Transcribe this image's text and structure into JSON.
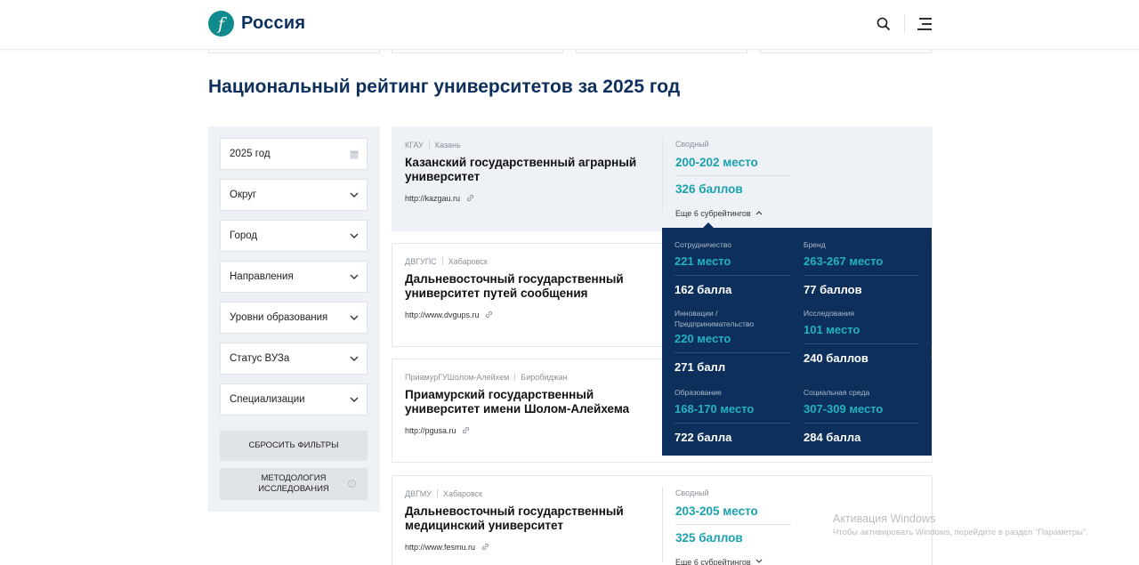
{
  "header": {
    "logo_glyph": "f",
    "logo_text": "Россия",
    "brand_color": "#0f8a8e",
    "search_icon": "search-icon",
    "menu_icon": "menu-icon"
  },
  "page": {
    "title": "Национальный рейтинг университетов за 2025 год"
  },
  "filters": {
    "year": "2025 год",
    "selects": [
      "Округ",
      "Город",
      "Направления",
      "Уровни образования",
      "Статус ВУЗа",
      "Специализации"
    ],
    "reset_label": "СБРОСИТЬ ФИЛЬТРЫ",
    "methodology_line1": "МЕТОДОЛОГИЯ",
    "methodology_line2": "ИССЛЕДОВАНИЯ",
    "info_glyph": "i"
  },
  "universities": [
    {
      "abbr": "КГАУ",
      "city": "Казань",
      "name": "Казанский государственный аграрный университет",
      "url": "http://kazgau.ru",
      "summary_label": "Сводный",
      "place": "200-202 место",
      "points": "326 баллов",
      "more": "Еще 6 субрейтингов",
      "expanded": true
    },
    {
      "abbr": "ДВГУПС",
      "city": "Хабаровск",
      "name": "Дальневосточный государственный университет путей сообщения",
      "url": "http://www.dvgups.ru"
    },
    {
      "abbr": "ПриамурГУШолом-Алейхем",
      "city": "Биробиджан",
      "name": "Приамурский государственный университет имени Шолом-Алейхема",
      "url": "http://pgusa.ru"
    },
    {
      "abbr": "ДВГМУ",
      "city": "Хабаровск",
      "name": "Дальневосточный государственный медицинский университет",
      "url": "http://www.fesmu.ru",
      "summary_label": "Сводный",
      "place": "203-205 место",
      "points": "325 баллов",
      "more": "Еще 6 субрейтингов",
      "expanded": false
    }
  ],
  "subratings": [
    {
      "label": "Сотрудничество",
      "place": "221 место",
      "points": "162 балла"
    },
    {
      "label": "Бренд",
      "place": "263-267 место",
      "points": "77 баллов"
    },
    {
      "label": "Инновации / Предпринимательство",
      "place": "220 место",
      "points": "271 балл"
    },
    {
      "label": "Исследования",
      "place": "101 место",
      "points": "240 баллов"
    },
    {
      "label": "Образование",
      "place": "168-170 место",
      "points": "722 балла"
    },
    {
      "label": "Социальная среда",
      "place": "307-309 место",
      "points": "284 балла"
    }
  ],
  "watermark": {
    "title": "Активация Windows",
    "subtitle": "Чтобы активировать Windows, перейдите в раздел \"Параметры\"."
  },
  "colors": {
    "navy": "#0d2f5c",
    "accent": "#1aa1b0",
    "panel": "#eef1f5"
  }
}
